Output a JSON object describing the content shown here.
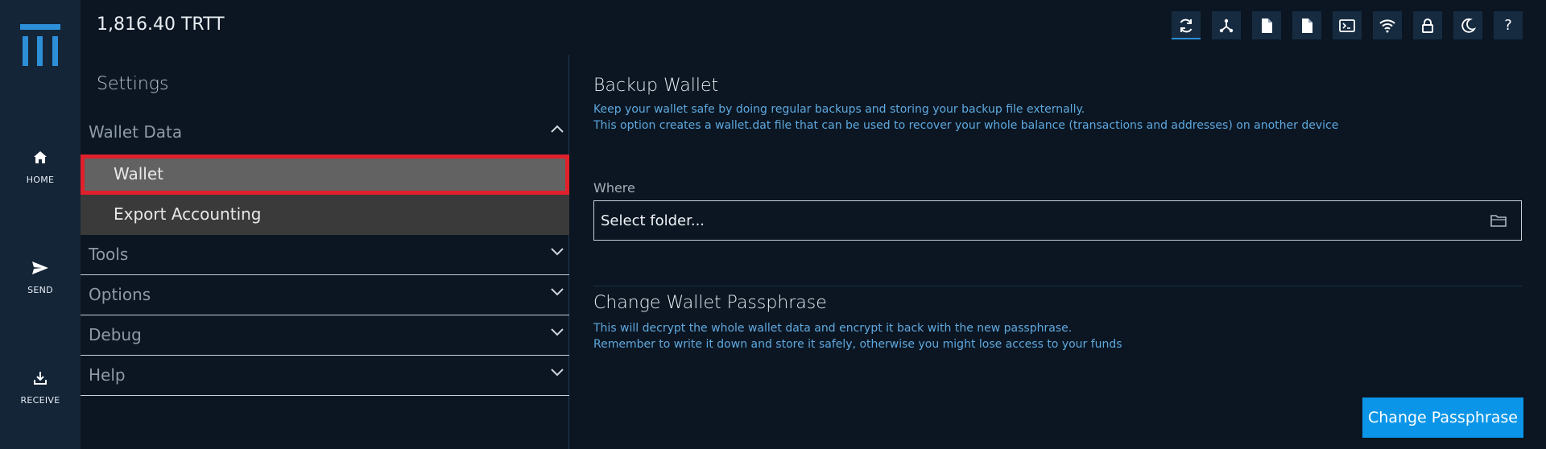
{
  "header": {
    "balance": "1,816.40 TRTT",
    "toolbar_icons": [
      "sync-icon",
      "network-icon",
      "document-icon",
      "document-icon",
      "terminal-icon",
      "wifi-icon",
      "lock-icon",
      "moon-icon",
      "help-icon"
    ],
    "help_label": "?"
  },
  "rail": {
    "items": [
      {
        "label": "HOME",
        "icon": "home-icon"
      },
      {
        "label": "SEND",
        "icon": "send-icon"
      },
      {
        "label": "RECEIVE",
        "icon": "download-icon"
      }
    ]
  },
  "settings": {
    "title": "Settings",
    "sections": [
      {
        "label": "Wallet Data",
        "expanded": true
      },
      {
        "label": "Tools",
        "expanded": false
      },
      {
        "label": "Options",
        "expanded": false
      },
      {
        "label": "Debug",
        "expanded": false
      },
      {
        "label": "Help",
        "expanded": false
      }
    ],
    "wallet_data_items": [
      {
        "label": "Wallet",
        "selected": true
      },
      {
        "label": "Export Accounting",
        "selected": false
      }
    ]
  },
  "backup": {
    "title": "Backup Wallet",
    "line1": "Keep your wallet safe by doing regular backups and storing your backup file externally.",
    "line2": "This option creates a wallet.dat file that can be used to recover your whole balance (transactions and addresses) on another device",
    "where_label": "Where",
    "folder_value": "Select folder..."
  },
  "passphrase": {
    "title": "Change Wallet Passphrase",
    "line1": "This will decrypt the whole wallet data and encrypt it back with the new passphrase.",
    "line2": "Remember to write it down and store it safely, otherwise you might lose access to your funds",
    "button_label": "Change Passphrase"
  },
  "colors": {
    "accent": "#0a95e8",
    "selection_outline": "#e0202a",
    "link_text": "#5fa8de"
  }
}
